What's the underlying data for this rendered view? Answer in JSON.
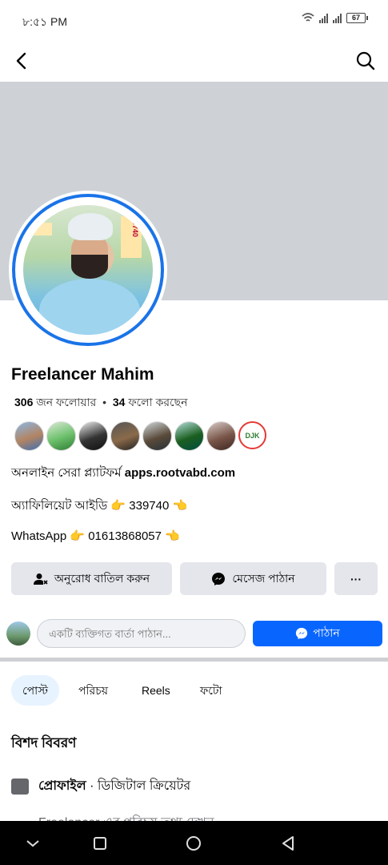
{
  "status_bar": {
    "time": "৮:৫১ PM",
    "battery": "67"
  },
  "profile": {
    "name": "Freelancer Mahim",
    "followers_count": "306",
    "followers_label": "জন ফলোয়ার",
    "separator": "•",
    "following_count": "34",
    "following_label": "ফলো করছেন",
    "photo_text_1": "৬9740",
    "photo_text_2": "der"
  },
  "friend_badge": "DJK",
  "bio": {
    "line1_text": "অনলাইন সেরা প্ল্যাটফর্ম ",
    "line1_link": "apps.rootvabd.com",
    "line2": "অ্যাফিলিয়েট আইডি 👉 339740 👈",
    "line3": "WhatsApp 👉 01613868057 👈"
  },
  "actions": {
    "cancel_request": "অনুরোধ বাতিল করুন",
    "message": "মেসেজ পাঠান",
    "more": "···"
  },
  "message_row": {
    "placeholder": "একটি ব্যক্তিগত বার্তা পাঠান...",
    "send": "পাঠান"
  },
  "tabs": [
    "পোস্ট",
    "পরিচয়",
    "Reels",
    "ফটো"
  ],
  "details": {
    "title": "বিশদ বিবরণ",
    "profile_label": "প্রোফাইল",
    "profile_value": " · ডিজিটাল ক্রিয়েটর",
    "about_line": "Freelancer এর পরিচয় তথ্য দেখুন"
  },
  "colors": {
    "accent": "#0866ff",
    "ring": "#1a73e8",
    "cover": "#ced1d6",
    "button_bg": "#e4e6eb"
  }
}
